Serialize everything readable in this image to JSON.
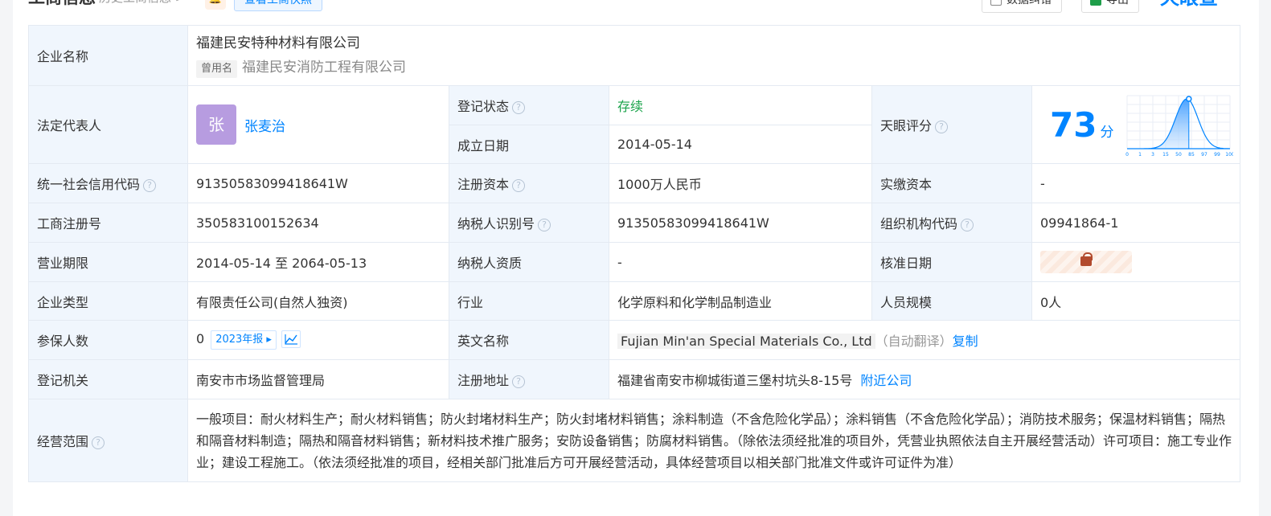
{
  "header": {
    "title": "工商信息",
    "history": "历史工商信息 >",
    "snapshot": "查看工商快照",
    "correct": "数据纠错",
    "export": "导出",
    "brand": "天眼查"
  },
  "company": {
    "name_label": "企业名称",
    "name": "福建民安特种材料有限公司",
    "former_tag": "曾用名",
    "former_name": "福建民安消防工程有限公司"
  },
  "legal": {
    "label": "法定代表人",
    "avatar": "张",
    "name": "张麦治"
  },
  "status": {
    "label": "登记状态",
    "value": "存续"
  },
  "founded": {
    "label": "成立日期",
    "value": "2014-05-14"
  },
  "score": {
    "label": "天眼评分",
    "value": "73",
    "unit": "分",
    "level": 73,
    "ticks": [
      "0",
      "1",
      "3",
      "15",
      "50",
      "85",
      "97",
      "99",
      "100"
    ]
  },
  "credit": {
    "label": "统一社会信用代码",
    "value": "91350583099418641W"
  },
  "capital": {
    "label": "注册资本",
    "value": "1000万人民币"
  },
  "paid": {
    "label": "实缴资本",
    "value": "-"
  },
  "regno": {
    "label": "工商注册号",
    "value": "350583100152634"
  },
  "taxid": {
    "label": "纳税人识别号",
    "value": "91350583099418641W"
  },
  "orgcode": {
    "label": "组织机构代码",
    "value": "09941864-1"
  },
  "period": {
    "label": "营业期限",
    "value": "2014-05-14 至 2064-05-13"
  },
  "taxq": {
    "label": "纳税人资质",
    "value": "-"
  },
  "approve": {
    "label": "核准日期"
  },
  "type": {
    "label": "企业类型",
    "value": "有限责任公司(自然人独资)"
  },
  "industry": {
    "label": "行业",
    "value": "化学原料和化学制品制造业"
  },
  "staff": {
    "label": "人员规模",
    "value": "0人"
  },
  "insured": {
    "label": "参保人数",
    "value": "0",
    "report": "2023年报 ▸"
  },
  "english": {
    "label": "英文名称",
    "value": "Fujian Min'an Special Materials Co., Ltd",
    "auto": "（自动翻译）",
    "copy": "复制"
  },
  "authority": {
    "label": "登记机关",
    "value": "南安市市场监督管理局"
  },
  "address": {
    "label": "注册地址",
    "value": "福建省南安市柳城街道三堡村坑头8-15号",
    "nearby": "附近公司"
  },
  "scope": {
    "label": "经营范围",
    "value": "一般项目：耐火材料生产；耐火材料销售；防火封堵材料生产；防火封堵材料销售；涂料制造（不含危险化学品）；涂料销售（不含危险化学品）；消防技术服务；保温材料销售；隔热和隔音材料制造；隔热和隔音材料销售；新材料技术推广服务；安防设备销售；防腐材料销售。（除依法须经批准的项目外，凭营业执照依法自主开展经营活动）许可项目：施工专业作业；建设工程施工。（依法须经批准的项目，经相关部门批准后方可开展经营活动，具体经营项目以相关部门批准文件或许可证件为准）"
  }
}
